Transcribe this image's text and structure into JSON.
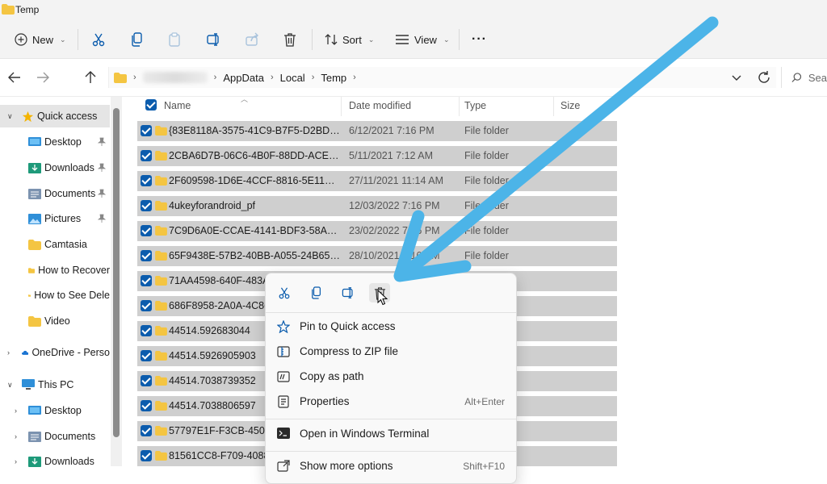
{
  "window": {
    "title": "Temp"
  },
  "toolbar": {
    "new_label": "New",
    "sort_label": "Sort",
    "view_label": "View",
    "more_label": "···"
  },
  "address": {
    "crumbs": [
      "AppData",
      "Local",
      "Temp"
    ],
    "search_placeholder": "Sea"
  },
  "sidebar": {
    "quick_access": "Quick access",
    "items": [
      {
        "label": "Desktop",
        "pinned": true,
        "icon": "desktop-icon"
      },
      {
        "label": "Downloads",
        "pinned": true,
        "icon": "downloads-icon"
      },
      {
        "label": "Documents",
        "pinned": true,
        "icon": "documents-icon"
      },
      {
        "label": "Pictures",
        "pinned": true,
        "icon": "pictures-icon"
      },
      {
        "label": "Camtasia",
        "pinned": false,
        "icon": "folder-icon"
      },
      {
        "label": "How to Recover",
        "pinned": false,
        "icon": "folder-icon"
      },
      {
        "label": "How to See Dele",
        "pinned": false,
        "icon": "folder-icon"
      },
      {
        "label": "Video",
        "pinned": false,
        "icon": "folder-icon"
      }
    ],
    "onedrive": "OneDrive - Perso",
    "this_pc": "This PC",
    "pc_items": [
      "Desktop",
      "Documents",
      "Downloads"
    ]
  },
  "columns": {
    "name": "Name",
    "date": "Date modified",
    "type": "Type",
    "size": "Size"
  },
  "files": [
    {
      "name": "{83E8118A-3575-41C9-B7F5-D2BDB5F...",
      "date": "6/12/2021 7:16 PM",
      "type": "File folder"
    },
    {
      "name": "2CBA6D7B-06C6-4B0F-88DD-ACE7446...",
      "date": "5/11/2021 7:12 AM",
      "type": "File folder"
    },
    {
      "name": "2F609598-1D6E-4CCF-8816-5E11BFD4...",
      "date": "27/11/2021 11:14 AM",
      "type": "File folder"
    },
    {
      "name": "4ukeyforandroid_pf",
      "date": "12/03/2022 7:16 PM",
      "type": "File folder"
    },
    {
      "name": "7C9D6A0E-CCAE-4141-BDF3-58ADF78...",
      "date": "23/02/2022 7:16 PM",
      "type": "File folder"
    },
    {
      "name": "65F9438E-57B2-40BB-A055-24B65A39...",
      "date": "28/10/2021 7:16 PM",
      "type": "File folder"
    },
    {
      "name": "71AA4598-640F-483A-",
      "date": "",
      "type": ""
    },
    {
      "name": "686F8958-2A0A-4C86-",
      "date": "",
      "type": ""
    },
    {
      "name": "44514.592683044",
      "date": "",
      "type": ""
    },
    {
      "name": "44514.5926905903",
      "date": "",
      "type": ""
    },
    {
      "name": "44514.7038739352",
      "date": "",
      "type": ""
    },
    {
      "name": "44514.7038806597",
      "date": "",
      "type": ""
    },
    {
      "name": "57797E1F-F3CB-4500-9",
      "date": "",
      "type": ""
    },
    {
      "name": "81561CC8-F709-4088-I",
      "date": "",
      "type": ""
    }
  ],
  "context_menu": {
    "items": [
      {
        "label": "Pin to Quick access",
        "shortcut": "",
        "icon": "pin-star-icon"
      },
      {
        "label": "Compress to ZIP file",
        "shortcut": "",
        "icon": "zip-icon"
      },
      {
        "label": "Copy as path",
        "shortcut": "",
        "icon": "copy-path-icon"
      },
      {
        "label": "Properties",
        "shortcut": "Alt+Enter",
        "icon": "properties-icon"
      },
      {
        "label": "Open in Windows Terminal",
        "shortcut": "",
        "icon": "terminal-icon"
      },
      {
        "label": "Show more options",
        "shortcut": "Shift+F10",
        "icon": "more-options-icon"
      }
    ]
  },
  "colors": {
    "accent": "#0b5cad",
    "folder": "#f4c542",
    "selection": "#cfcfcf",
    "annotation_arrow": "#4cb4e8"
  }
}
